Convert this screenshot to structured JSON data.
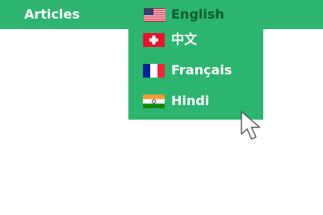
{
  "nav": {
    "articles_label": "Articles",
    "language_label": "English",
    "language_flag": "us-flag-icon"
  },
  "language_menu": {
    "items": [
      {
        "label": "中文",
        "flag": "swiss-flag-icon"
      },
      {
        "label": "Français",
        "flag": "french-flag-icon"
      },
      {
        "label": "Hindi",
        "flag": "india-flag-icon"
      }
    ]
  },
  "colors": {
    "brand_green": "#2db56f",
    "active_text": "#0f5a30",
    "text": "#ffffff"
  }
}
